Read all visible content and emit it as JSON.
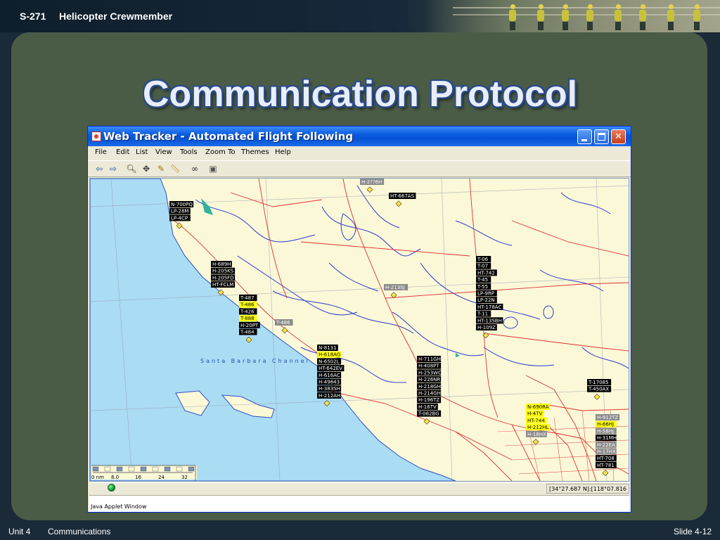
{
  "slide": {
    "course": "S-271",
    "subject": "Helicopter Crewmember",
    "title": "Communication Protocol",
    "footer_unit": "Unit 4",
    "footer_section": "Communications",
    "footer_slide": "Slide 4-12"
  },
  "window": {
    "title": "Web Tracker - Automated Flight Following",
    "menu": [
      "File",
      "Edit",
      "List",
      "View",
      "Tools",
      "Zoom To",
      "Themes",
      "Help"
    ],
    "toolbar_icons": [
      "back-arrow-icon",
      "forward-arrow-icon",
      "zoom-icon",
      "pan-icon",
      "select-icon",
      "measure-icon",
      "binoculars-icon",
      "print-icon"
    ],
    "status_coords": "[34°27.687 N]:[118°07.816 W]",
    "applet_label": "Java Applet Window"
  },
  "map": {
    "water_label": "Santa Barbara Channel",
    "scale_labels": [
      "0 nm",
      "8.0",
      "16",
      "24",
      "32"
    ],
    "colors": {
      "land": "#fbf8d8",
      "water": "#aadcf4",
      "road": "#e03030",
      "river": "#2a3acc",
      "label_bg": "#000000",
      "label_highlight": "#ffff00",
      "label_grey": "#8a8a8a"
    },
    "groups": [
      {
        "labels": [
          {
            "t": "H-2??6H",
            "s": "grey"
          }
        ]
      },
      {
        "labels": [
          {
            "t": "HT-667AS",
            "s": "black"
          }
        ]
      },
      {
        "labels": [
          {
            "t": "N-700PQ",
            "s": "black"
          },
          {
            "t": "LP-28M",
            "s": "black"
          },
          {
            "t": "LP-4CP",
            "s": "black"
          }
        ]
      },
      {
        "labels": [
          {
            "t": "H-689H",
            "s": "black"
          },
          {
            "t": "H-205KS",
            "s": "black"
          },
          {
            "t": "H-205FD",
            "s": "black"
          },
          {
            "t": "HT-FCLM",
            "s": "black"
          }
        ]
      },
      {
        "labels": [
          {
            "t": "T-487",
            "s": "black"
          },
          {
            "t": "T-486",
            "s": "yellow"
          },
          {
            "t": "T-426",
            "s": "black"
          },
          {
            "t": "T-888",
            "s": "yellow"
          },
          {
            "t": "H-20PT",
            "s": "black"
          },
          {
            "t": "T-484",
            "s": "black"
          }
        ]
      },
      {
        "labels": [
          {
            "t": "T-486",
            "s": "grey"
          }
        ]
      },
      {
        "labels": [
          {
            "t": "H-213SJ",
            "s": "grey"
          }
        ]
      },
      {
        "labels": [
          {
            "t": "T-06",
            "s": "black"
          },
          {
            "t": "T-07",
            "s": "black"
          },
          {
            "t": "HT-742",
            "s": "black"
          },
          {
            "t": "T-45",
            "s": "black"
          },
          {
            "t": "T-55",
            "s": "black"
          },
          {
            "t": "LP-9RP",
            "s": "black"
          },
          {
            "t": "LP-22N",
            "s": "black"
          },
          {
            "t": "HT-178AC",
            "s": "black"
          },
          {
            "t": "T-11",
            "s": "black"
          },
          {
            "t": "HT-135BH",
            "s": "black"
          },
          {
            "t": "H-109Z",
            "s": "black"
          }
        ]
      },
      {
        "labels": [
          {
            "t": "N-8131",
            "s": "black"
          },
          {
            "t": "H-618AG",
            "s": "yellow"
          },
          {
            "t": "N-6502L",
            "s": "black"
          },
          {
            "t": "HT-642EV",
            "s": "black"
          },
          {
            "t": "H-616AC",
            "s": "black"
          },
          {
            "t": "H-49643",
            "s": "black"
          },
          {
            "t": "H-383SH",
            "s": "black"
          },
          {
            "t": "H-212AH",
            "s": "black"
          }
        ]
      },
      {
        "labels": [
          {
            "t": "H-711GH",
            "s": "black"
          },
          {
            "t": "H-408PT",
            "s": "black"
          },
          {
            "t": "H-253WC",
            "s": "black"
          },
          {
            "t": "H-226NR",
            "s": "black"
          },
          {
            "t": "H-218GH",
            "s": "black"
          },
          {
            "t": "H-214GH",
            "s": "black"
          },
          {
            "t": "H-196TZ",
            "s": "black"
          },
          {
            "t": "H-16TV",
            "s": "black"
          },
          {
            "t": "T-062BG",
            "s": "black"
          }
        ]
      },
      {
        "labels": [
          {
            "t": "T-17085",
            "s": "black"
          },
          {
            "t": "T-450AX",
            "s": "black"
          }
        ]
      },
      {
        "labels": [
          {
            "t": "N-690RA",
            "s": "yellow"
          },
          {
            "t": "H-4TV",
            "s": "yellow"
          },
          {
            "t": "HT-744",
            "s": "yellow"
          },
          {
            "t": "H-212HL",
            "s": "yellow"
          },
          {
            "t": "H-18HX",
            "s": "grey"
          }
        ]
      },
      {
        "labels": [
          {
            "t": "H-912TZ",
            "s": "grey"
          },
          {
            "t": "H-66HJ",
            "s": "yellow"
          },
          {
            "t": "H-58HJ",
            "s": "grey"
          },
          {
            "t": "H-31MH",
            "s": "black"
          },
          {
            "t": "H-22EA",
            "s": "grey"
          },
          {
            "t": "H-17HX",
            "s": "grey"
          },
          {
            "t": "HT-708",
            "s": "black"
          },
          {
            "t": "HT-781",
            "s": "black"
          }
        ]
      }
    ]
  }
}
